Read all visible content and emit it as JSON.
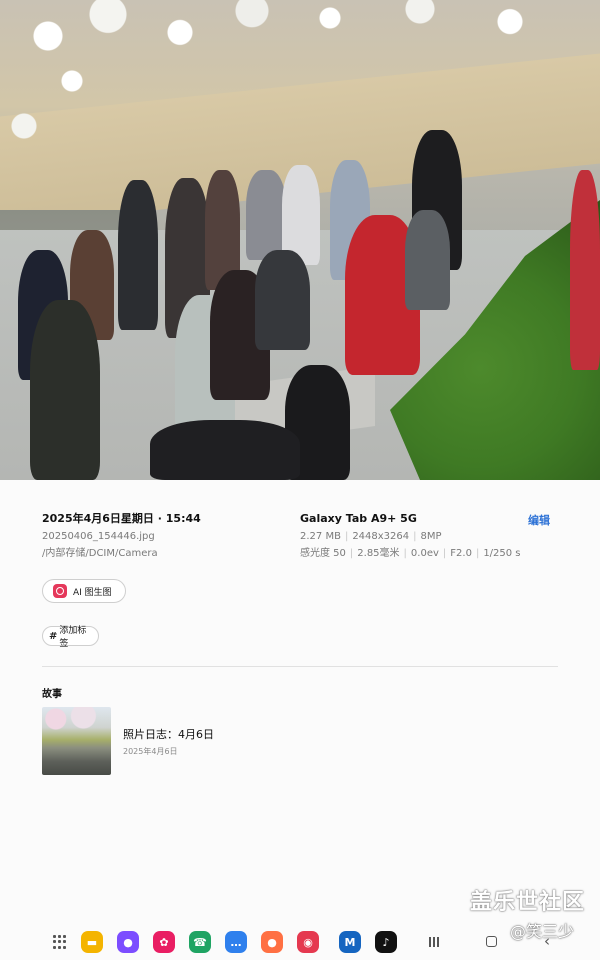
{
  "photo": {
    "subject": "photo-viewer-image"
  },
  "details": {
    "datetime": "2025年4月6日星期日 · 15:44",
    "filename": "20250406_154446.jpg",
    "path": "/内部存储/DCIM/Camera",
    "device": "Galaxy Tab A9+ 5G",
    "file_size": "2.27 MB",
    "resolution": "2448x3264",
    "megapixels": "8MP",
    "iso": "感光度 50",
    "focal": "2.85毫米",
    "ev": "0.0ev",
    "aperture": "F2.0",
    "shutter": "1/250 s",
    "edit_label": "编辑"
  },
  "chips": {
    "ai_label": "AI 图生图",
    "tag_label": "添加标签"
  },
  "story": {
    "section_title": "故事",
    "name": "照片日志：4月6日",
    "date": "2025年4月6日"
  },
  "watermark": {
    "line1": "盖乐世社区",
    "line2": "@笑三少"
  },
  "taskbar": {
    "apps": [
      {
        "name": "files-app-icon",
        "color": "#f4b400"
      },
      {
        "name": "internet-app-icon",
        "color": "#7c4dff"
      },
      {
        "name": "gallery-app-icon",
        "color": "#e91e63"
      },
      {
        "name": "phone-app-icon",
        "color": "#1fa463"
      },
      {
        "name": "messages-app-icon",
        "color": "#2f80ed"
      },
      {
        "name": "contacts-app-icon",
        "color": "#ff7043"
      },
      {
        "name": "camera-app-icon",
        "color": "#e53950"
      },
      {
        "name": "m-app-icon",
        "color": "#1565c0"
      },
      {
        "name": "tiktok-app-icon",
        "color": "#111111"
      }
    ]
  }
}
